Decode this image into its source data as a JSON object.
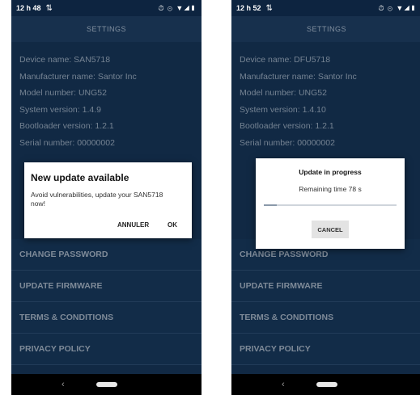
{
  "left": {
    "status": {
      "time": "12 h 48",
      "signal": "⇅",
      "icons": "⏱ ⊙ ▼◢▮"
    },
    "title": "SETTINGS",
    "info": [
      "Device name: SAN5718",
      "Manufacturer name: Santor Inc",
      "Model number: UNG52",
      "System version: 1.4.9",
      "Bootloader version: 1.2.1",
      "Serial number: 00000002"
    ],
    "menu": [
      "CHANGE PASSWORD",
      "UPDATE FIRMWARE",
      "TERMS & CONDITIONS",
      "PRIVACY POLICY"
    ],
    "dialog": {
      "title": "New update available",
      "message": "Avoid vulnerabilities, update your SAN5718 now!",
      "cancel_label": "ANNULER",
      "ok_label": "OK"
    },
    "nav": {
      "back": "‹"
    }
  },
  "right": {
    "status": {
      "time": "12 h 52",
      "signal": "⇅",
      "icons": "⏱ ⊙ ▼◢▮"
    },
    "title": "SETTINGS",
    "info": [
      "Device name: DFU5718",
      "Manufacturer name: Santor Inc",
      "Model number: UNG52",
      "System version: 1.4.10",
      "Bootloader version: 1.2.1",
      "Serial number: 00000002"
    ],
    "menu": [
      "CHANGE PASSWORD",
      "UPDATE FIRMWARE",
      "TERMS & CONDITIONS",
      "PRIVACY POLICY"
    ],
    "dialog": {
      "title": "Update in progress",
      "remaining": "Remaining time 78 s",
      "progress": 0.1,
      "cancel_label": "CANCEL"
    },
    "nav": {
      "back": "‹"
    }
  },
  "colors": {
    "background": "#153254",
    "accent": "#1d3b5e",
    "dialog": "#ffffff"
  }
}
